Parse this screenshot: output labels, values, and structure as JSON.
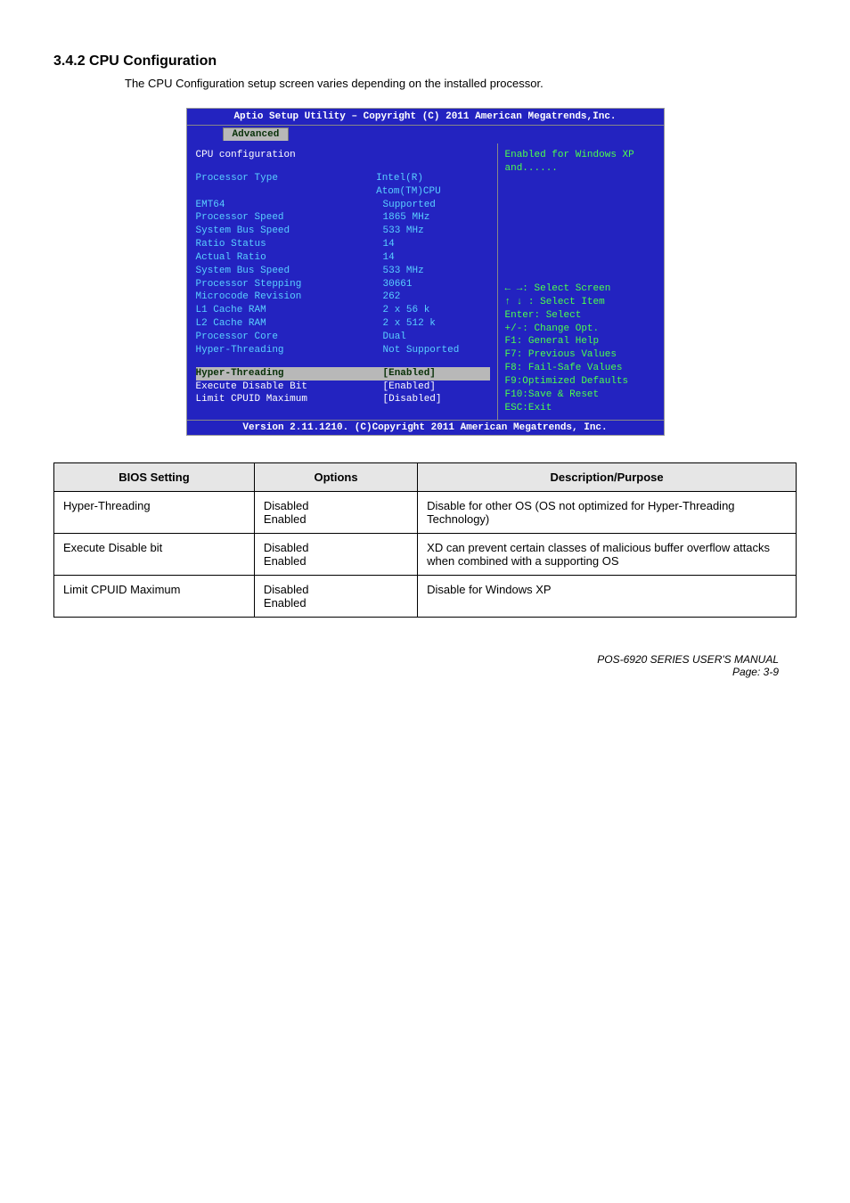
{
  "heading": "3.4.2 CPU Configuration",
  "subtitle": "The CPU Configuration setup screen varies depending on the installed processor.",
  "bios": {
    "title": "Aptio Setup Utility – Copyright (C) 2011 American Megatrends,Inc.",
    "tab": "Advanced",
    "panel_title": "CPU configuration",
    "rows": [
      {
        "label": "Processor Type",
        "value": "Intel(R) Atom(TM)CPU"
      },
      {
        "label": "EMT64",
        "value": "Supported"
      },
      {
        "label": "Processor Speed",
        "value": "1865 MHz"
      },
      {
        "label": "System Bus Speed",
        "value": "533 MHz"
      },
      {
        "label": "Ratio Status",
        "value": "14"
      },
      {
        "label": "Actual Ratio",
        "value": "14"
      },
      {
        "label": "System Bus Speed",
        "value": "533 MHz"
      },
      {
        "label": "Processor Stepping",
        "value": "30661"
      },
      {
        "label": "Microcode Revision",
        "value": "262"
      },
      {
        "label": "L1 Cache RAM",
        "value": "2 x 56 k"
      },
      {
        "label": "L2 Cache RAM",
        "value": "2 x 512 k"
      },
      {
        "label": "Processor Core",
        "value": "Dual"
      },
      {
        "label": "Hyper-Threading",
        "value": "Not Supported"
      }
    ],
    "editable": [
      {
        "label": "Hyper-Threading",
        "value": "[Enabled]"
      },
      {
        "label": "Execute Disable Bit",
        "value": "[Enabled]"
      },
      {
        "label": "Limit CPUID Maximum",
        "value": "[Disabled]"
      }
    ],
    "help_top": "Enabled for Windows XP and......",
    "help_nav": [
      "← →:  Select Screen",
      "↑ ↓ : Select Item",
      "Enter: Select",
      "+/-:   Change Opt.",
      "F1: General Help",
      "F7: Previous Values",
      "F8: Fail-Safe Values",
      "F9:Optimized Defaults",
      "F10:Save & Reset",
      "ESC:Exit"
    ],
    "footer": "Version 2.11.1210. (C)Copyright 2011 American Megatrends, Inc."
  },
  "table": {
    "headers": [
      "BIOS Setting",
      "Options",
      "Description/Purpose"
    ],
    "rows": [
      {
        "setting": "Hyper-Threading",
        "options": "Disabled\nEnabled",
        "desc": "Disable for other OS (OS not optimized for Hyper-Threading Technology)"
      },
      {
        "setting": "Execute Disable bit",
        "options": "Disabled\nEnabled",
        "desc": "XD can prevent certain classes of malicious buffer overflow attacks when combined with a supporting OS"
      },
      {
        "setting": "Limit CPUID Maximum",
        "options": "Disabled\nEnabled",
        "desc": "Disable for Windows XP"
      }
    ]
  },
  "page_footer": {
    "num": "POS-6920 SERIES USER'S MANUAL",
    "title": "Page: 3-9"
  }
}
